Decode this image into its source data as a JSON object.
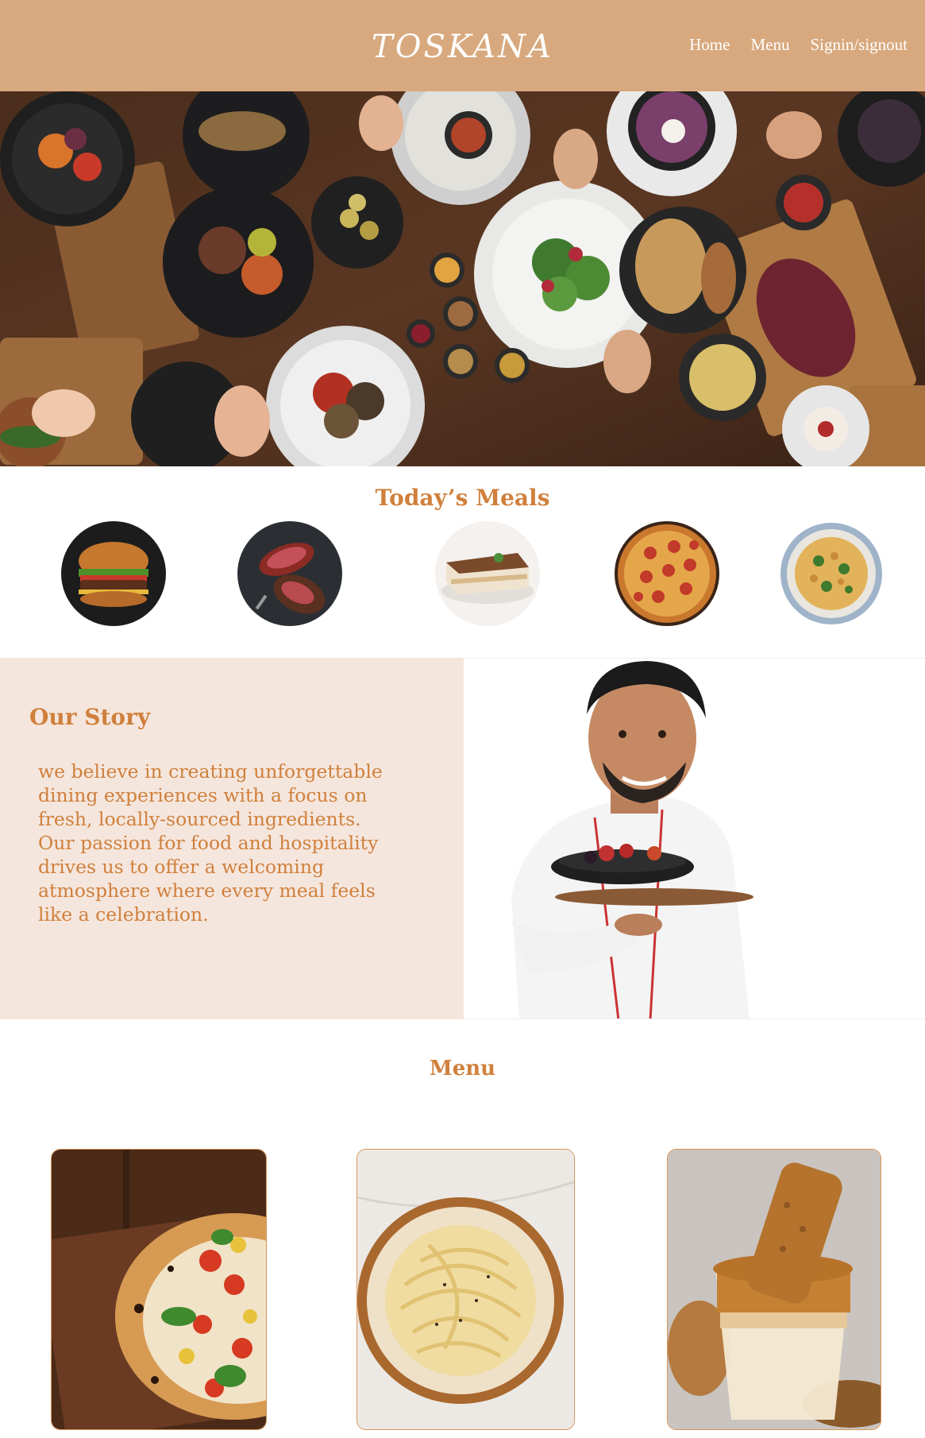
{
  "header": {
    "logo": "TOSKANA",
    "nav": {
      "home": "Home",
      "menu": "Menu",
      "signin": "Signin/signout"
    },
    "background_color": "#D8A97E"
  },
  "hero": {
    "image": "dining-table-spread-photo"
  },
  "todays_meals": {
    "title": "Today’s Meals",
    "items": [
      {
        "image": "burger-photo"
      },
      {
        "image": "steak-photo"
      },
      {
        "image": "tiramisu-photo"
      },
      {
        "image": "pepperoni-pizza-photo"
      },
      {
        "image": "penne-pasta-photo"
      }
    ]
  },
  "story": {
    "title": "Our Story",
    "text": "we believe in creating unforgettable dining experiences with a focus on fresh, locally-sourced ingredients. Our passion for food and hospitality drives us to offer a welcoming atmosphere where every meal feels like a celebration.",
    "image": "chef-holding-dessert-photo"
  },
  "menu": {
    "title": "Menu",
    "cards": [
      {
        "image": "margherita-pizza-photo"
      },
      {
        "image": "spaghetti-carbonara-photo"
      },
      {
        "image": "biscoff-dessert-cup-photo"
      }
    ]
  },
  "colors": {
    "accent": "#D0803C",
    "story_bg": "#F5E6DD"
  }
}
